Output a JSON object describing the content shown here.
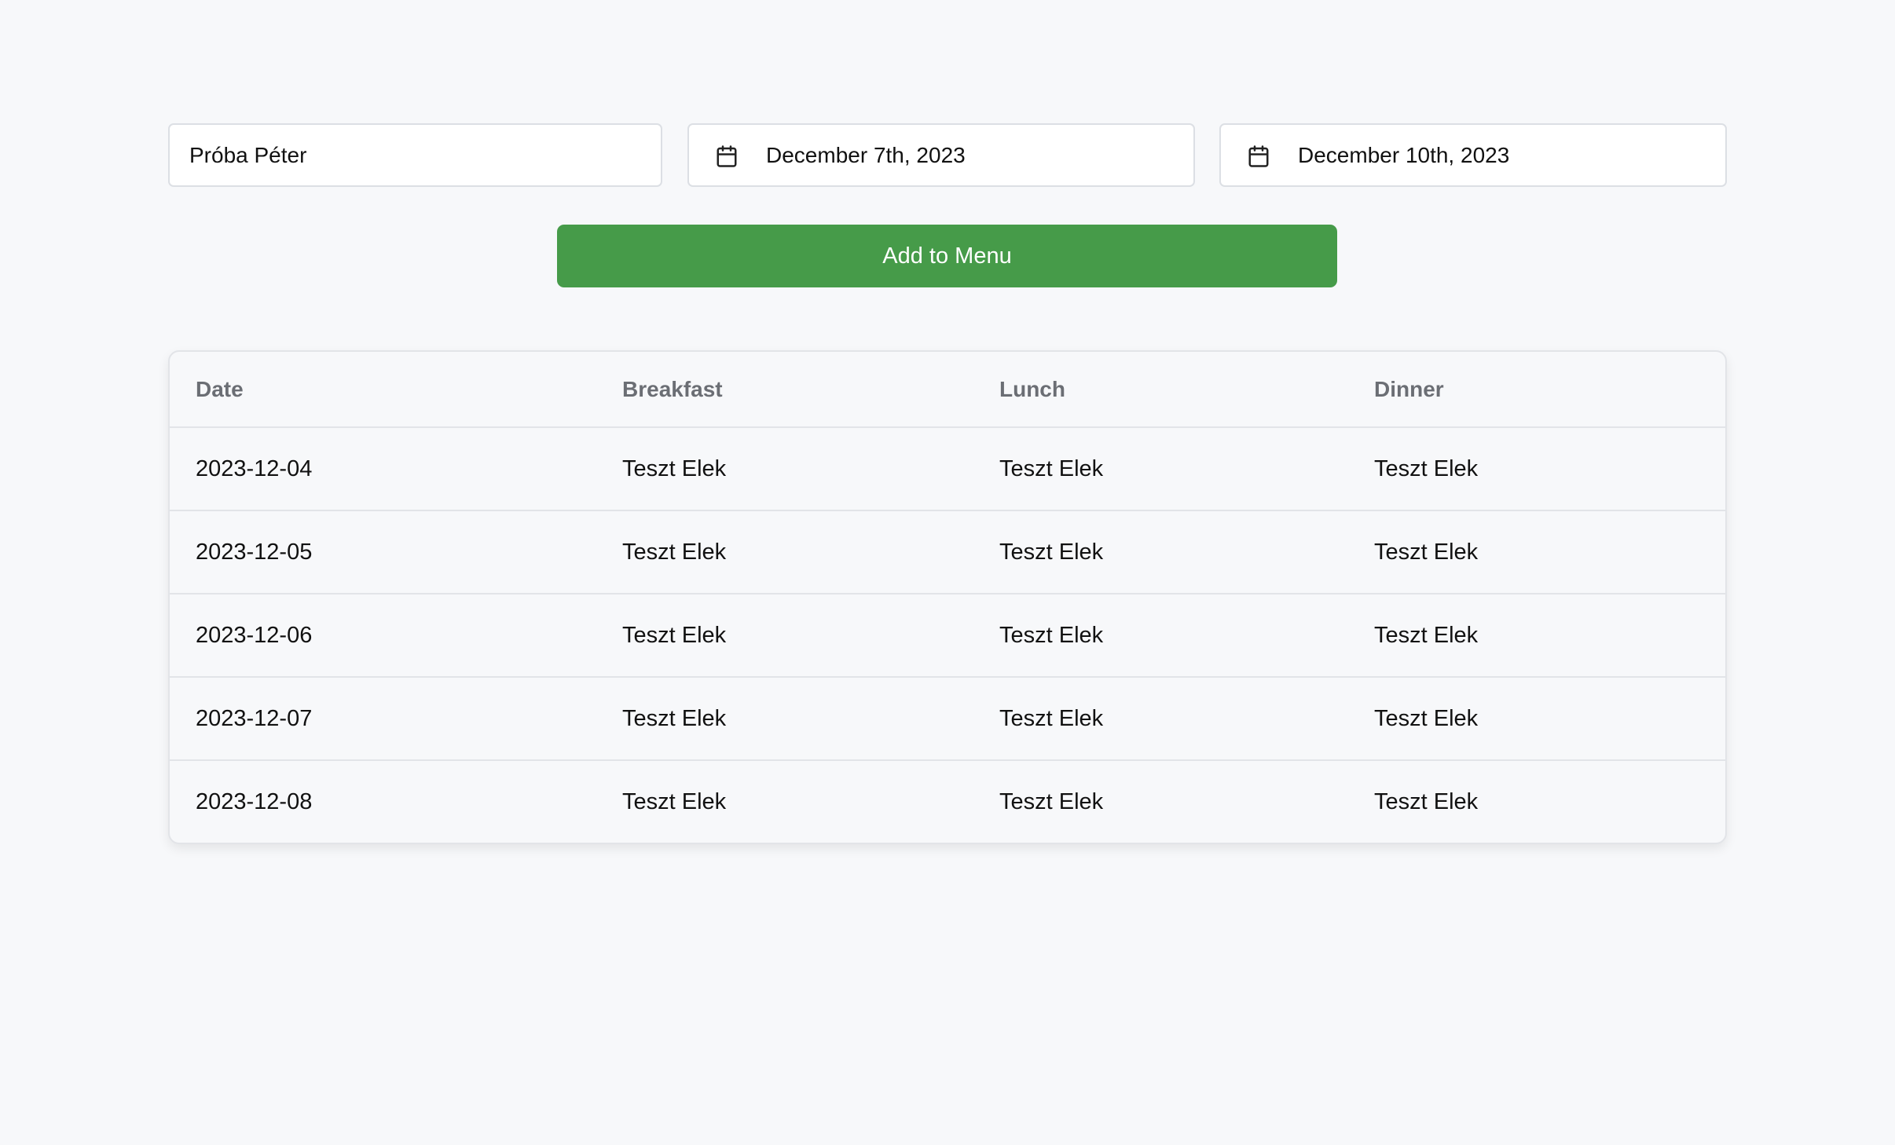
{
  "form": {
    "name_value": "Próba Péter",
    "start_date": "December 7th, 2023",
    "end_date": "December 10th, 2023",
    "add_button_label": "Add to Menu",
    "calendar_icon": "calendar-icon"
  },
  "table": {
    "headers": {
      "date": "Date",
      "breakfast": "Breakfast",
      "lunch": "Lunch",
      "dinner": "Dinner"
    },
    "rows": [
      {
        "date": "2023-12-04",
        "breakfast": "Teszt Elek",
        "lunch": "Teszt Elek",
        "dinner": "Teszt Elek"
      },
      {
        "date": "2023-12-05",
        "breakfast": "Teszt Elek",
        "lunch": "Teszt Elek",
        "dinner": "Teszt Elek"
      },
      {
        "date": "2023-12-06",
        "breakfast": "Teszt Elek",
        "lunch": "Teszt Elek",
        "dinner": "Teszt Elek"
      },
      {
        "date": "2023-12-07",
        "breakfast": "Teszt Elek",
        "lunch": "Teszt Elek",
        "dinner": "Teszt Elek"
      },
      {
        "date": "2023-12-08",
        "breakfast": "Teszt Elek",
        "lunch": "Teszt Elek",
        "dinner": "Teszt Elek"
      }
    ]
  },
  "colors": {
    "background": "#f7f8fa",
    "button": "#469b49",
    "button_text": "#ffffff",
    "header_text": "#6b6e74",
    "border": "#e2e4e8"
  }
}
